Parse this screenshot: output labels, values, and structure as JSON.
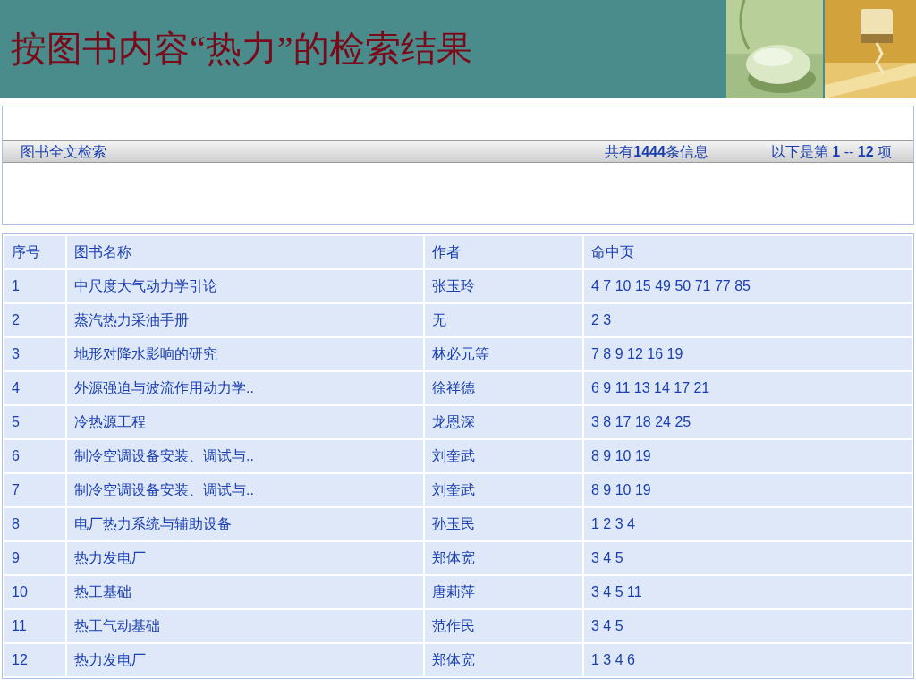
{
  "slide_title": "按图书内容“热力”的检索结果",
  "search_bar": {
    "label": "图书全文检索",
    "total": "共有**1444**条信息",
    "range": "以下是第 **1** -- **12** 项"
  },
  "table": {
    "columns": [
      "序号",
      "图书名称",
      "作者",
      "命中页"
    ],
    "rows": [
      [
        "1",
        "中尺度大气动力学引论",
        "张玉玲",
        "4 7 10 15 49 50 71 77 85"
      ],
      [
        "2",
        "蒸汽热力采油手册",
        "无",
        "2 3"
      ],
      [
        "3",
        "地形对降水影响的研究",
        "林必元等",
        "7 8 9 12 16 19"
      ],
      [
        "4",
        "外源强迫与波流作用动力学..",
        "徐祥德",
        "6 9 11 13 14 17 21"
      ],
      [
        "5",
        "冷热源工程",
        "龙恩深",
        "3 8 17 18 24 25"
      ],
      [
        "6",
        "制冷空调设备安装、调试与..",
        "刘奎武",
        "8 9 10 19"
      ],
      [
        "7",
        "制冷空调设备安装、调试与..",
        "刘奎武",
        "8 9 10 19"
      ],
      [
        "8",
        "电厂热力系统与辅助设备",
        "孙玉民",
        "1 2 3 4"
      ],
      [
        "9",
        "热力发电厂",
        "郑体宽",
        "3 4 5"
      ],
      [
        "10",
        "热工基础",
        "唐莉萍",
        "3 4 5 11"
      ],
      [
        "11",
        "热工气动基础",
        "范作民",
        "3 4 5"
      ],
      [
        "12",
        "热力发电厂",
        "郑体宽",
        "1 3 4 6"
      ]
    ]
  }
}
